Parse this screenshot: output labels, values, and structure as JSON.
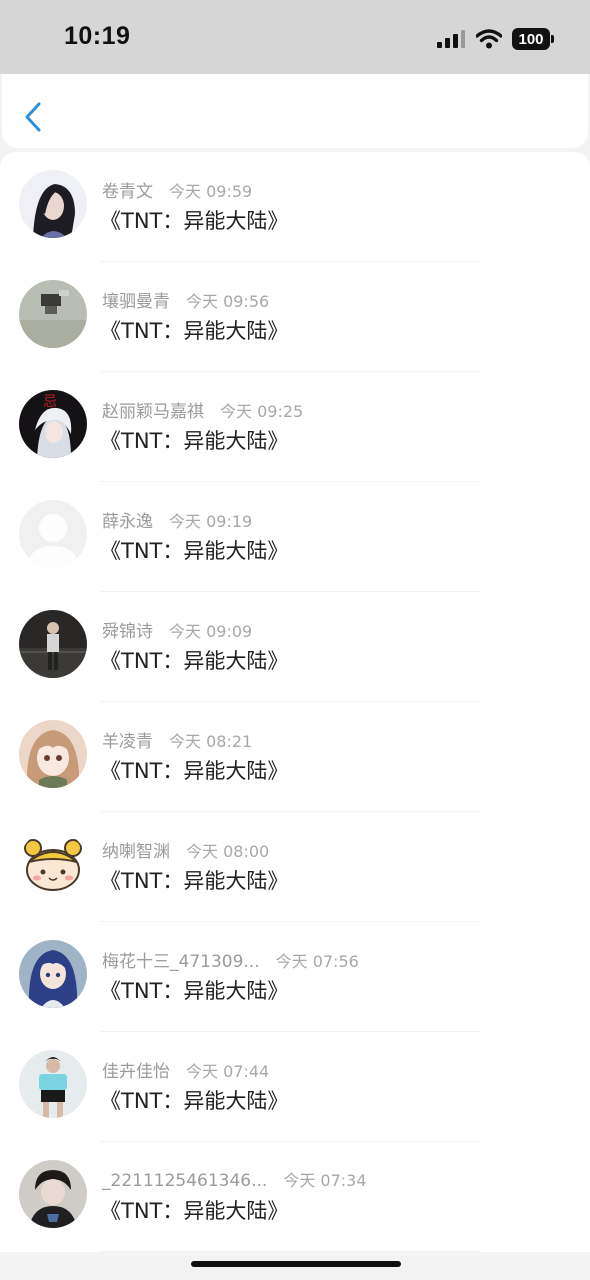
{
  "status_bar": {
    "time": "10:19",
    "battery": "100"
  },
  "nav": {
    "back_icon": "chevron-left-icon",
    "accent": "#2b8fdc"
  },
  "items": [
    {
      "name": "卷青文",
      "time": "今天 09:59",
      "text": "《TNT：异能大陆》",
      "avatar": "girl-dark-hair-avatar"
    },
    {
      "name": "壤驷曼青",
      "time": "今天 09:56",
      "text": "《TNT：异能大陆》",
      "avatar": "grey-photo-avatar"
    },
    {
      "name": "赵丽颖马嘉祺",
      "time": "今天 09:25",
      "text": "《TNT：异能大陆》",
      "avatar": "anime-silver-hair-avatar"
    },
    {
      "name": "薛永逸",
      "time": "今天 09:19",
      "text": "《TNT：异能大陆》",
      "avatar": "default-person-avatar"
    },
    {
      "name": "舜锦诗",
      "time": "今天 09:09",
      "text": "《TNT：异能大陆》",
      "avatar": "standing-person-avatar"
    },
    {
      "name": "羊凌青",
      "time": "今天 08:21",
      "text": "《TNT：异能大陆》",
      "avatar": "anime-girl-avatar"
    },
    {
      "name": "纳喇智渊",
      "time": "今天 08:00",
      "text": "《TNT：异能大陆》",
      "avatar": "cartoon-face-avatar"
    },
    {
      "name": "梅花十三_471309...",
      "time": "今天 07:56",
      "text": "《TNT：异能大陆》",
      "avatar": "anime-blue-hair-avatar"
    },
    {
      "name": "佳卉佳怡",
      "time": "今天 07:44",
      "text": "《TNT：异能大陆》",
      "avatar": "dancer-photo-avatar"
    },
    {
      "name": "_2211125461346...",
      "time": "今天 07:34",
      "text": "《TNT：异能大陆》",
      "avatar": "boy-photo-avatar"
    }
  ]
}
